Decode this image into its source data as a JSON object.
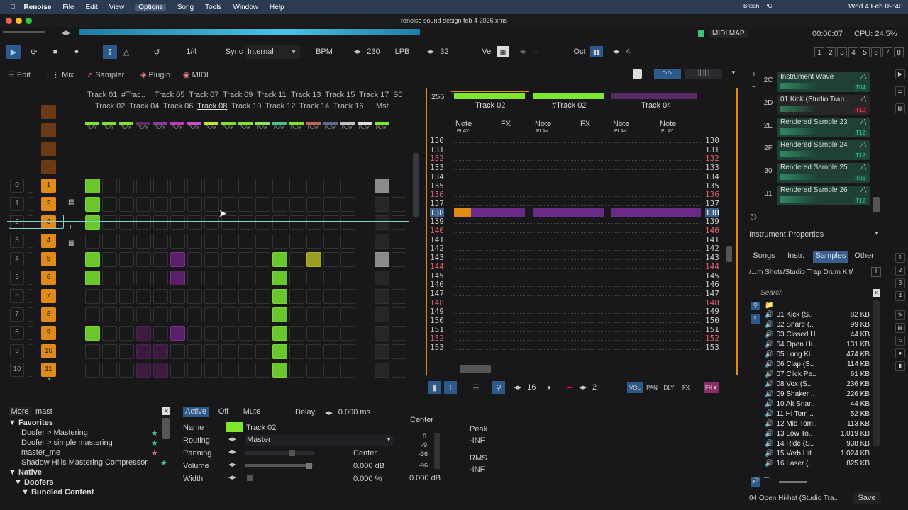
{
  "menubar": {
    "app": "Renoise",
    "items": [
      "File",
      "Edit",
      "View",
      "Options",
      "Song",
      "Tools",
      "Window",
      "Help"
    ],
    "locale": "British - PC",
    "datetime": "Wed 4 Feb 09:40"
  },
  "window_title": "renoise sound design feb 4 2026.xrns",
  "status": {
    "midi_map": "MIDI MAP",
    "time": "00:00:07",
    "cpu": "CPU: 24.5%"
  },
  "transport": {
    "lpb_step": "1/4",
    "sync_label": "Sync",
    "sync_value": "Internal",
    "bpm_label": "BPM",
    "bpm": "230",
    "lpb_label": "LPB",
    "lpb": "32",
    "vel_label": "Vel",
    "vel_value": "--",
    "oct_label": "Oct",
    "oct": "4",
    "track_nums": [
      "1",
      "2",
      "3",
      "4",
      "5",
      "6",
      "7",
      "8"
    ]
  },
  "views": {
    "edit": "Edit",
    "mix": "Mix",
    "sampler": "Sampler",
    "plugin": "Plugin",
    "midi": "MIDI"
  },
  "tracks_top": [
    "Track 01",
    "#Trac..",
    "Track 05",
    "Track 07",
    "Track 09",
    "Track 11",
    "Track 13",
    "Track 15",
    "Track 17",
    "S0"
  ],
  "tracks_bottom": [
    "Track 02",
    "Track 04",
    "Track 06",
    "Track 08",
    "Track 10",
    "Track 12",
    "Track 14",
    "Track 16",
    "Mst"
  ],
  "play_label": "PLAY",
  "sequence": {
    "numbers": [
      "0",
      "1",
      "2",
      "3",
      "4",
      "5",
      "6",
      "7",
      "8",
      "9",
      "10"
    ],
    "patterns": [
      "1",
      "2",
      "3",
      "4",
      "5",
      "6",
      "7",
      "8",
      "9",
      "10",
      "11"
    ]
  },
  "pattern_editor": {
    "length": "256",
    "tracks": [
      "Track 02",
      "#Track 02",
      "Track 04"
    ],
    "col_note": "Note",
    "col_fx": "FX",
    "rows": [
      "130",
      "131",
      "132",
      "133",
      "134",
      "135",
      "136",
      "137",
      "138",
      "139",
      "140",
      "141",
      "142",
      "143",
      "144",
      "145",
      "146",
      "147",
      "148",
      "149",
      "150",
      "151",
      "152",
      "153"
    ],
    "current_row": "138",
    "red_rows": [
      "132",
      "136",
      "140",
      "144",
      "148",
      "152"
    ]
  },
  "pattern_bottom": {
    "step": "16",
    "step2": "2",
    "vol": "VOL",
    "pan": "PAN",
    "dly": "DLY",
    "fx": "FX"
  },
  "instruments": [
    {
      "num": "2C",
      "name": "Instrument Wave",
      "tag": "T04"
    },
    {
      "num": "2D",
      "name": "01 Kick (Studio Trap..",
      "tag": "T10"
    },
    {
      "num": "2E",
      "name": "Rendered Sample 23",
      "tag": "T12"
    },
    {
      "num": "2F",
      "name": "Rendered Sample 24",
      "tag": "T12"
    },
    {
      "num": "30",
      "name": "Rendered Sample 25",
      "tag": "T06"
    },
    {
      "num": "31",
      "name": "Rendered Sample 26",
      "tag": "T12"
    }
  ],
  "instrument_properties": "Instrument Properties",
  "browser": {
    "tabs": [
      "Songs",
      "Instr.",
      "Samples",
      "Other"
    ],
    "path": "/...m Shots/Studio Trap Drum Kit/",
    "search_placeholder": "Search",
    "up": "..",
    "files": [
      {
        "name": "01 Kick (S..",
        "size": "82 KB"
      },
      {
        "name": "02 Snare (..",
        "size": "99 KB"
      },
      {
        "name": "03 Closed H..",
        "size": "44 KB"
      },
      {
        "name": "04 Open Hi..",
        "size": "131 KB"
      },
      {
        "name": "05 Long Ki..",
        "size": "474 KB"
      },
      {
        "name": "06 Clap (S..",
        "size": "114 KB"
      },
      {
        "name": "07 Click Pe..",
        "size": "61 KB"
      },
      {
        "name": "08 Vox (S..",
        "size": "236 KB"
      },
      {
        "name": "09 Shaker ..",
        "size": "226 KB"
      },
      {
        "name": "10 Alt Snar..",
        "size": "44 KB"
      },
      {
        "name": "11 Hi Tom ..",
        "size": "52 KB"
      },
      {
        "name": "12 Mid Tom..",
        "size": "113 KB"
      },
      {
        "name": "13 Low To..",
        "size": "1.019 KB"
      },
      {
        "name": "14 Ride (S..",
        "size": "938 KB"
      },
      {
        "name": "15 Verb Hit..",
        "size": "1.024 KB"
      },
      {
        "name": "16 Laser (..",
        "size": "825 KB"
      }
    ],
    "status": "04 Open Hi-hat (Studio Tra..",
    "save": "Save"
  },
  "plugins": {
    "more": "More",
    "search": "mast",
    "favorites": "Favorites",
    "items": [
      "Doofer > Mastering",
      "Doofer > simple mastering",
      "master_me",
      "Shadow Hills Mastering Compressor"
    ],
    "native": "Native",
    "doofers": "Doofers",
    "bundled": "Bundled Content"
  },
  "track_props": {
    "active": "Active",
    "off": "Off",
    "mute": "Mute",
    "delay_label": "Delay",
    "delay": "0.000 ms",
    "name_label": "Name",
    "name": "Track 02",
    "routing_label": "Routing",
    "routing": "Master",
    "panning_label": "Panning",
    "panning": "Center",
    "volume_label": "Volume",
    "volume": "0.000 dB",
    "width_label": "Width",
    "width": "0.000 %"
  },
  "meter": {
    "center": "Center",
    "scale": [
      "0",
      "-9",
      "-36",
      "-96"
    ],
    "db": "0.000 dB",
    "peak": "Peak",
    "peak_val": "-INF",
    "rms": "RMS",
    "rms_val": "-INF"
  }
}
